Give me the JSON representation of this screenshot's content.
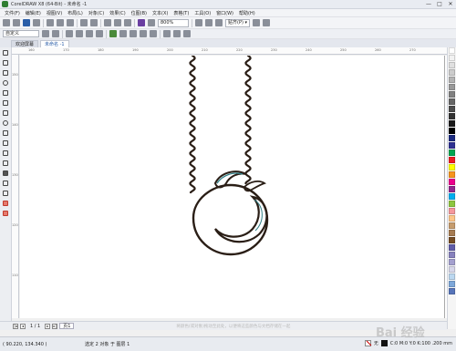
{
  "window": {
    "title": "CorelDRAW X8 (64-Bit) - 未命名 -1",
    "controls": [
      "—",
      "□",
      "✕"
    ]
  },
  "menubar": {
    "items": [
      "文件(F)",
      "编辑(E)",
      "视图(V)",
      "布局(L)",
      "对象(C)",
      "效果(C)",
      "位图(B)",
      "文本(X)",
      "表格(T)",
      "工具(O)",
      "窗口(W)",
      "帮助(H)"
    ]
  },
  "toolbar": {
    "zoom_value": "800%",
    "snap_label": "贴齐(P) ▾"
  },
  "propbar": {
    "preset_label": "自定义"
  },
  "doc_tabs": {
    "welcome": "欢迎屏幕",
    "document": "未命名 -1"
  },
  "ruler": {
    "top_ticks": [
      "160",
      "170",
      "180",
      "190",
      "200",
      "210",
      "220",
      "230",
      "240",
      "250",
      "260",
      "270"
    ],
    "left_ticks": [
      "150",
      "140",
      "130",
      "120",
      "110"
    ]
  },
  "bottombar": {
    "page_indicator": "1 / 1",
    "page_tab": "页1",
    "hint": "将颜色(或对象)拖动至此处，以便将这些颜色与文档存储在一起"
  },
  "statusbar": {
    "coords": "( 90.220, 134.340 )",
    "selection_info": "选定 2 对象 于 图层 1",
    "fill_label": "无",
    "outline_label": "C:0 M:0 Y:0 K:100 .200 mm"
  },
  "palette": {
    "colors": [
      "#ffffff",
      "#f2f2f2",
      "#e0e0e0",
      "#cccccc",
      "#b3b3b3",
      "#999999",
      "#808080",
      "#666666",
      "#4d4d4d",
      "#333333",
      "#1a1a1a",
      "#000000",
      "#1b2a80",
      "#2e3192",
      "#00a651",
      "#ed1c24",
      "#ffff00",
      "#f7941d",
      "#ec008c",
      "#92278f",
      "#00aeef",
      "#8dc63f",
      "#f5989d",
      "#fdc689",
      "#c69c6d",
      "#a67c52",
      "#754c24",
      "#605ca8",
      "#8781bd",
      "#a4a0cf",
      "#d7d7ea",
      "#bcd8f0",
      "#7da7d9",
      "#5674b9"
    ]
  },
  "watermark": "Bai 经验"
}
